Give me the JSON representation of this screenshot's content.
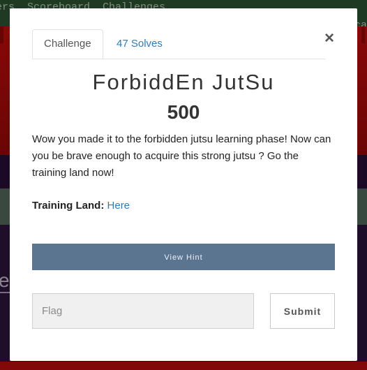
{
  "background": {
    "nav_left": "ers  Scoreboard  Challenges",
    "nav_right": "Notifica"
  },
  "modal": {
    "close_symbol": "×",
    "tabs": [
      {
        "label": "Challenge",
        "active": true
      },
      {
        "label": "47 Solves",
        "active": false
      }
    ],
    "title": "ForbiddEn JutSu",
    "points": "500",
    "description": "Wow you made it to the forbidden jutsu learning phase! Now can you be brave enough to acquire this strong jutsu ? Go the training land now!",
    "training_land_label": "Training Land:",
    "training_land_link": "Here",
    "hint_button": "View Hint",
    "flag_placeholder": "Flag",
    "submit_label": "Submit"
  },
  "colors": {
    "accent_link": "#2e7bb8",
    "hint_button": "#5b7591"
  }
}
